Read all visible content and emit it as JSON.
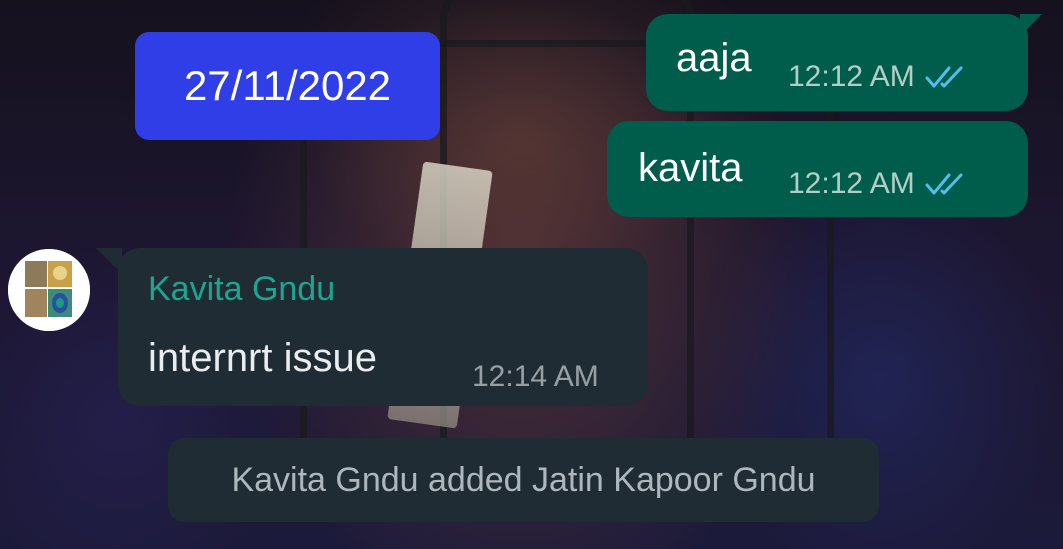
{
  "chat": {
    "date_separator": "27/11/2022",
    "outgoing_messages": [
      {
        "text": "aaja",
        "time": "12:12 AM",
        "status": "read-double-tick"
      },
      {
        "text": "kavita",
        "time": "12:12 AM",
        "status": "read-double-tick"
      }
    ],
    "incoming_message": {
      "sender": "Kavita Gndu",
      "text": "internrt issue",
      "time": "12:14 AM"
    },
    "system_message": "Kavita Gndu added Jatin Kapoor Gndu"
  },
  "icons": {
    "read_receipt": "double-check-icon",
    "avatar": "avatar-collage"
  },
  "colors": {
    "outgoing_bubble": "#005c4b",
    "incoming_bubble": "#1f2c33",
    "date_badge": "#2f3ee6",
    "sender_name": "#1fa58f",
    "read_tick": "#53bdeb"
  }
}
